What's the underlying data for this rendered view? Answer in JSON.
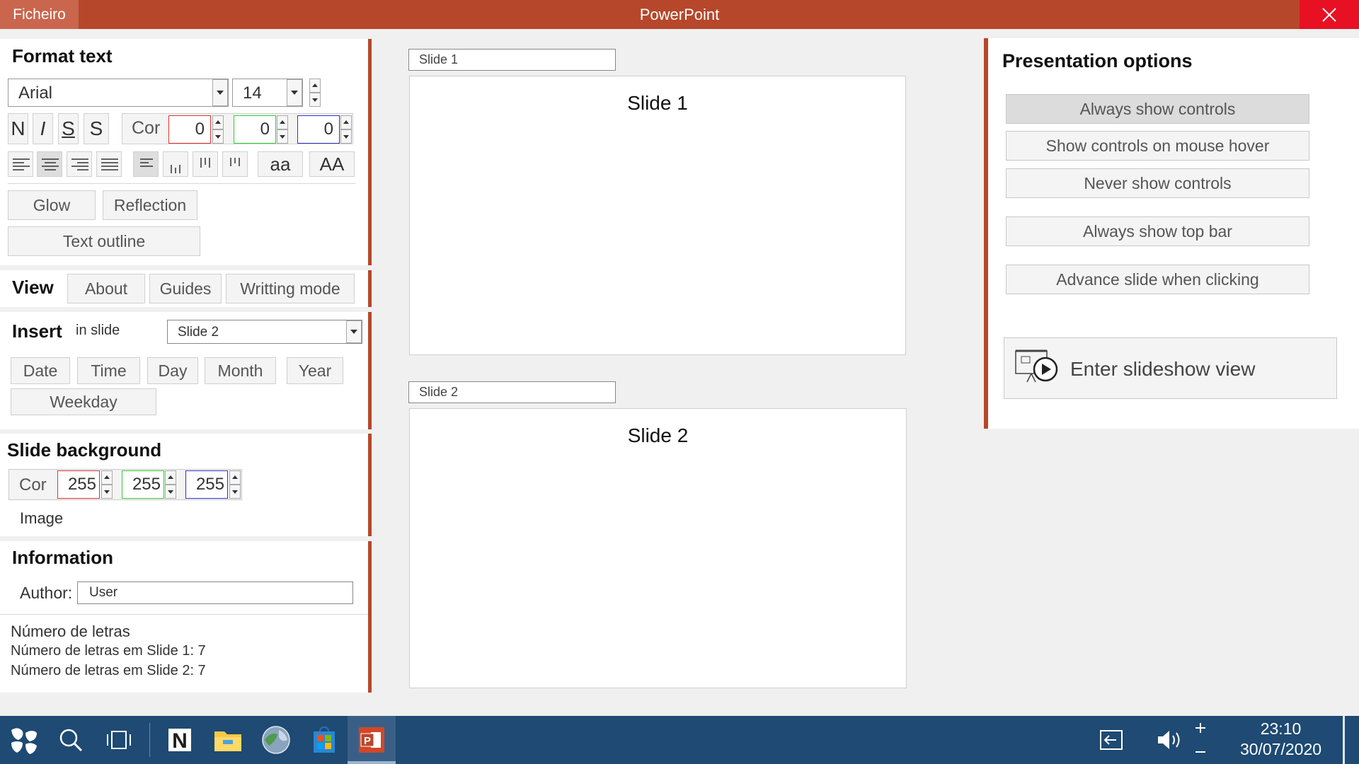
{
  "app": {
    "title": "PowerPoint",
    "file_menu": "Ficheiro"
  },
  "format_text": {
    "title": "Format text",
    "font": "Arial",
    "size": "14",
    "styles": [
      "N",
      "I",
      "S",
      "S"
    ],
    "color_label": "Cor",
    "color": {
      "r": "0",
      "g": "0",
      "b": "0"
    },
    "case_lower": "aa",
    "case_upper": "AA",
    "effects": [
      "Glow",
      "Reflection",
      "Text outline"
    ]
  },
  "view": {
    "title": "View",
    "buttons": [
      "About",
      "Guides",
      "Writting mode"
    ]
  },
  "insert": {
    "title": "Insert",
    "in_slide_label": "in slide",
    "selected_slide": "Slide 2",
    "buttons": [
      "Date",
      "Time",
      "Day",
      "Month",
      "Year",
      "Weekday"
    ]
  },
  "slide_background": {
    "title": "Slide background",
    "color_label": "Cor",
    "color": {
      "r": "255",
      "g": "255",
      "b": "255"
    },
    "image_label": "Image"
  },
  "information": {
    "title": "Information",
    "author_label": "Author:",
    "author_value": "User",
    "letters_title": "Número de letras",
    "letters_lines": [
      "Número de letras em Slide 1: 7",
      "Número de letras em Slide 2: 7"
    ]
  },
  "slides": [
    {
      "name": "Slide 1",
      "title": "Slide 1"
    },
    {
      "name": "Slide 2",
      "title": "Slide 2"
    }
  ],
  "presentation_options": {
    "title": "Presentation options",
    "buttons": [
      "Always show controls",
      "Show controls on mouse hover",
      "Never show controls",
      "Always show top bar",
      "Advance slide when clicking"
    ],
    "slideshow": "Enter slideshow view"
  },
  "clock": {
    "time": "23:10",
    "date": "30/07/2020"
  },
  "colors": {
    "accent": "#b7472a",
    "taskbar": "#1e4a73",
    "close": "#e81123"
  },
  "icons": [
    "start-icon",
    "search-icon",
    "task-view-icon",
    "onenote-icon",
    "file-explorer-icon",
    "browser-icon",
    "store-icon",
    "powerpoint-icon",
    "input-indicator-icon",
    "volume-icon"
  ]
}
